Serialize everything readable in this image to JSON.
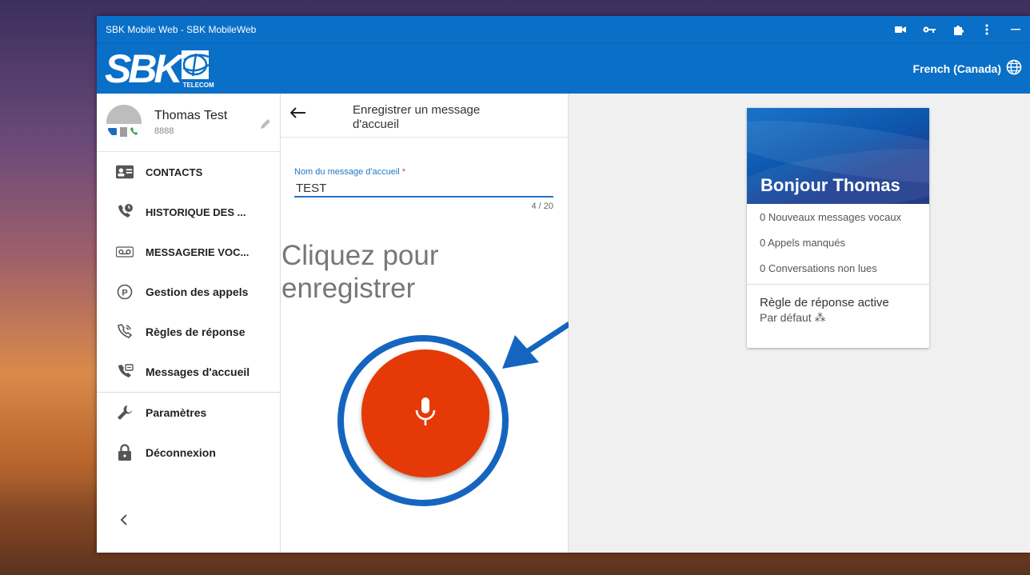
{
  "window": {
    "title": "SBK Mobile Web - SBK MobileWeb"
  },
  "header": {
    "logo_text": "SBK",
    "logo_subtext": "TELECOM",
    "language": "French (Canada)"
  },
  "profile": {
    "name": "Thomas Test",
    "extension": "8888"
  },
  "nav": {
    "contacts": "CONTACTS",
    "history": "HISTORIQUE DES ...",
    "voicemail": "MESSAGERIE VOC...",
    "call_management": "Gestion des appels",
    "answer_rules": "Règles de réponse",
    "greetings": "Messages d'accueil",
    "settings": "Paramètres",
    "logout": "Déconnexion"
  },
  "middle": {
    "title": "Enregistrer un message d'accueil",
    "field_label": "Nom du message d'accueil",
    "field_required": "*",
    "field_value": "TEST",
    "counter": "4 / 20",
    "prompt": "Cliquez pour enregistrer"
  },
  "card": {
    "greeting": "Bonjour Thomas",
    "stats": {
      "voicemails": "0 Nouveaux messages vocaux",
      "missed_calls": "0 Appels manqués",
      "unread": "0 Conversations non lues"
    },
    "rule_label": "Règle de réponse active",
    "rule_value": "Par défaut ⁂"
  },
  "colors": {
    "primary": "#0a6fc7",
    "record": "#e53908",
    "highlight": "#1565c0"
  },
  "icons": {
    "titlebar": [
      "video-icon",
      "key-icon",
      "puzzle-icon",
      "more-vert-icon",
      "minimize-icon"
    ],
    "language": "globe-icon"
  }
}
